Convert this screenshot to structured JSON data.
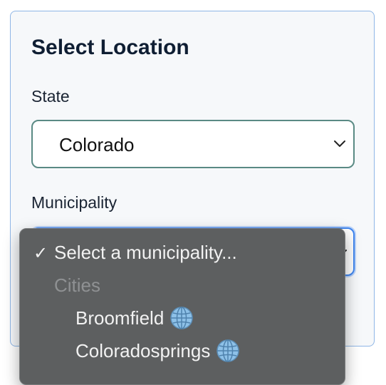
{
  "form": {
    "title": "Select Location",
    "state_label": "State",
    "state_value": "Colorado",
    "municipality_label": "Municipality"
  },
  "dropdown": {
    "selected_mark": "✓",
    "selected_option": "Select a municipality...",
    "group_label": "Cities",
    "options": [
      {
        "label": "Broomfield",
        "icon": "globe-icon"
      },
      {
        "label": "Coloradosprings",
        "icon": "globe-icon"
      }
    ]
  },
  "colors": {
    "card_border": "#8fb6e6",
    "state_select_border": "#5a8a84",
    "focus_border": "#3f86f0",
    "popup_bg": "#5d5f60"
  }
}
